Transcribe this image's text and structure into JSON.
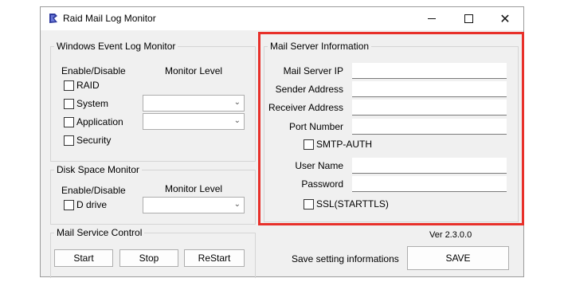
{
  "window": {
    "title": "Raid Mail Log Monitor",
    "close_glyph": "✕",
    "icon": "app-logo-icon"
  },
  "event_log": {
    "legend": "Windows Event Log Monitor",
    "enable_header": "Enable/Disable",
    "level_header": "Monitor Level",
    "items": [
      {
        "label": "RAID"
      },
      {
        "label": "System"
      },
      {
        "label": "Application"
      },
      {
        "label": "Security"
      }
    ]
  },
  "disk": {
    "legend": "Disk Space Monitor",
    "enable_header": "Enable/Disable",
    "level_header": "Monitor Level",
    "drive_label": "D drive"
  },
  "mail_service": {
    "legend": "Mail Service Control",
    "start": "Start",
    "stop": "Stop",
    "restart": "ReStart"
  },
  "mail_server": {
    "legend": "Mail Server Information",
    "ip_label": "Mail Server IP",
    "sender_label": "Sender Address",
    "receiver_label": "Receiver Address",
    "port_label": "Port Number",
    "smtp_auth_label": "SMTP-AUTH",
    "username_label": "User Name",
    "password_label": "Password",
    "ssl_label": "SSL(STARTTLS)"
  },
  "footer": {
    "version": "Ver 2.3.0.0",
    "save_hint": "Save setting informations",
    "save": "SAVE"
  },
  "colors": {
    "highlight": "#e8302a",
    "window_bg": "#f0f0f0"
  }
}
